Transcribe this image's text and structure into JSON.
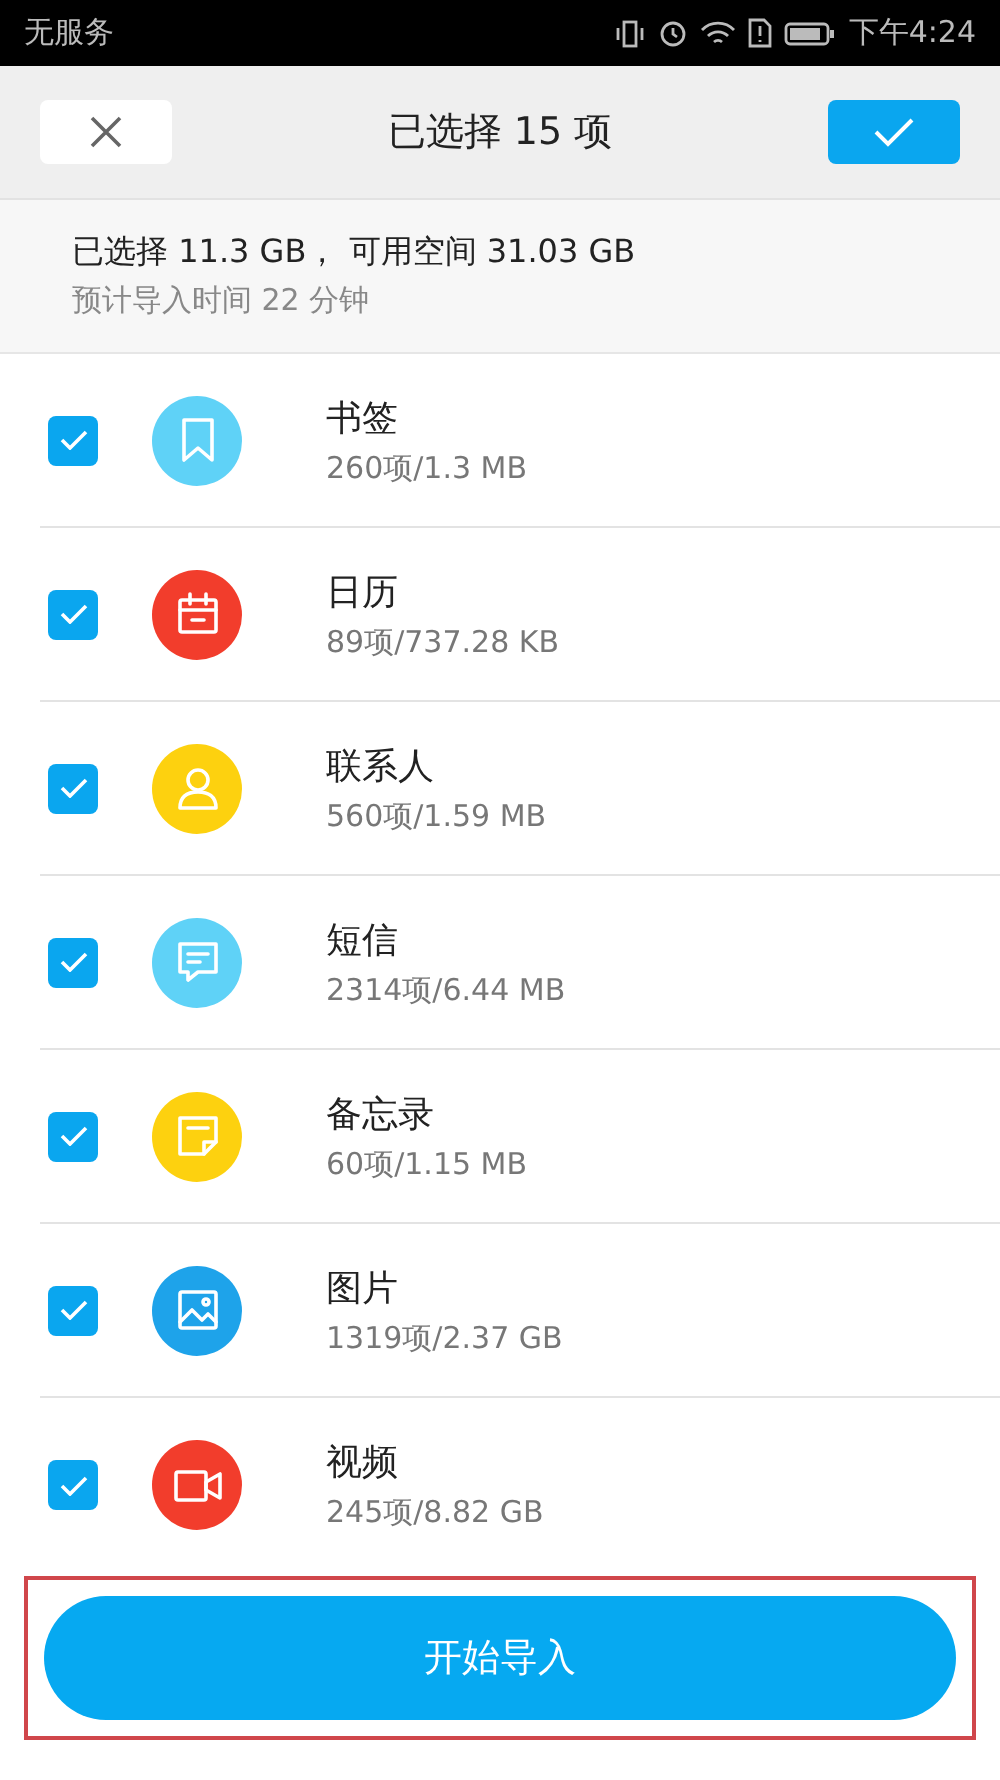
{
  "status_bar": {
    "carrier": "无服务",
    "time": "下午4:24"
  },
  "header": {
    "title": "已选择 15 项"
  },
  "summary": {
    "line_1": "已选择 11.3 GB， 可用空间 31.03 GB",
    "line_2": "预计导入时间 22 分钟"
  },
  "items": [
    {
      "name": "书签",
      "detail": "260项/1.3 MB",
      "checked": true,
      "kind": "bookmark",
      "color": "#5fd2f7"
    },
    {
      "name": "日历",
      "detail": "89项/737.28 KB",
      "checked": true,
      "kind": "calendar",
      "color": "#f23d2c"
    },
    {
      "name": "联系人",
      "detail": "560项/1.59 MB",
      "checked": true,
      "kind": "contact",
      "color": "#fdd10f"
    },
    {
      "name": "短信",
      "detail": "2314项/6.44 MB",
      "checked": true,
      "kind": "message",
      "color": "#5fd2f7"
    },
    {
      "name": "备忘录",
      "detail": "60项/1.15 MB",
      "checked": true,
      "kind": "note",
      "color": "#fdd10f"
    },
    {
      "name": "图片",
      "detail": "1319项/2.37 GB",
      "checked": true,
      "kind": "image",
      "color": "#1ea3ea"
    },
    {
      "name": "视频",
      "detail": "245项/8.82 GB",
      "checked": true,
      "kind": "video",
      "color": "#f23d2c"
    }
  ],
  "action": {
    "label": "开始导入"
  }
}
